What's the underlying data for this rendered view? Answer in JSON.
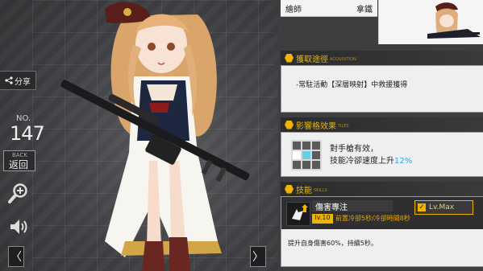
{
  "left_rail": {
    "share_label": "分享",
    "no_label": "NO.",
    "no_value": "147",
    "back_small": "BACK",
    "back_label": "返回"
  },
  "artist": {
    "label": "繪師",
    "name": "拿鐵"
  },
  "acquisition": {
    "title": "獲取途徑",
    "sub": "ACQUISITION",
    "text": "-常駐活動【深層映射】中救援獲得"
  },
  "tiles": {
    "title": "影響格效果",
    "sub": "TILES",
    "line1": "對手槍有效，",
    "line2_prefix": "技能冷卻速度上升",
    "line2_value": "12%"
  },
  "skill": {
    "title": "技能",
    "sub": "SKILLS",
    "name": "傷害專注",
    "level": "lv.10",
    "cooldown": "前置冷卻5秒/冷卻時間8秒",
    "lv_max": "Lv.Max",
    "description": "提升自身傷害60%，持續5秒。"
  },
  "nav": {
    "prev": "〈",
    "next": "〉"
  },
  "colors": {
    "accent": "#f0b400",
    "tile_effect": "#5fd3e4"
  }
}
